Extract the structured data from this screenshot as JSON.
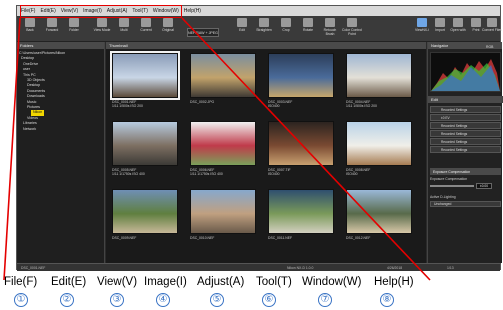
{
  "menubar": {
    "items": [
      "File(F)",
      "Edit(E)",
      "View(V)",
      "Image(I)",
      "Adjust(A)",
      "Tool(T)",
      "Window(W)",
      "Help(H)"
    ]
  },
  "toolbar": {
    "left": [
      "Back",
      "Forward",
      "Folder"
    ],
    "view": [
      "View Mode",
      "Multi",
      "Current",
      "Original"
    ],
    "dropdown": "NEF/RAW + JPEG",
    "edit": [
      "Edit",
      "Straighten",
      "Crop",
      "Rotate",
      "Retouch Brush",
      "Color Control Point"
    ],
    "right": [
      "ViewNX-i",
      "Import",
      "Open with",
      "Print",
      "Convert Files"
    ]
  },
  "left_panel": {
    "title": "Folders",
    "tree": [
      "C:\\Users\\user\\Pictures\\Nikon",
      "Desktop",
      "OneDrive",
      "user",
      "This PC",
      "3D Objects",
      "Desktop",
      "Documents",
      "Downloads",
      "Music",
      "Pictures",
      "Nikon",
      "Videos",
      "Libraries",
      "Network"
    ],
    "selected": "Nikon"
  },
  "center": {
    "title": "Thumbnail",
    "thumbnails": [
      {
        "name": "DSC_0001.NEF",
        "meta": "1/11 1/500s ISO 200"
      },
      {
        "name": "DSC_0002.JPG",
        "meta": ""
      },
      {
        "name": "DSC_0003.NEF",
        "meta": "ISO400"
      },
      {
        "name": "DSC_0004.NEF",
        "meta": "1/11 1/500s ISO 200"
      },
      {
        "name": "DSC_0005.NEF",
        "meta": "1/11 1/1750s ISO 400"
      },
      {
        "name": "DSC_0006.NEF",
        "meta": "1/11 1/1750s ISO 400"
      },
      {
        "name": "DSC_0007.TIF",
        "meta": "ISO400"
      },
      {
        "name": "DSC_0008.NEF",
        "meta": "ISO400"
      },
      {
        "name": "DSC_0009.NEF",
        "meta": ""
      },
      {
        "name": "DSC_0010.NEF",
        "meta": ""
      },
      {
        "name": "DSC_0011.NEF",
        "meta": ""
      },
      {
        "name": "DSC_0012.NEF",
        "meta": ""
      }
    ]
  },
  "right_panel": {
    "navigator": "Navigator",
    "hist_label": "RGB",
    "edit_title": "Edit",
    "settings": [
      "Recorded Settings",
      "±0 EV",
      "Recorded Settings",
      "Recorded Settings",
      "Recorded Settings",
      "Recorded Settings"
    ],
    "exposure_title": "Exposure Compensation",
    "exposure_label": "Exposure Compensation",
    "exposure_value": "±0.00",
    "dlighting_label": "Active D-Lighting",
    "dlighting_value": "Unchanged"
  },
  "status": {
    "left": "DSC_0001.NEF",
    "center": "Nikon NX-D 1.0.0",
    "right": "4/26/2018",
    "page": "1/13"
  },
  "legend": {
    "labels": [
      "File(F)",
      "Edit(E)",
      "View(V)",
      "Image(I)",
      "Adjust(A)",
      "Tool(T)",
      "Window(W)",
      "Help(H)"
    ],
    "numbers": [
      "①",
      "②",
      "③",
      "④",
      "⑤",
      "⑥",
      "⑦",
      "⑧"
    ]
  },
  "colors": {
    "highlight": "#e40000",
    "number_circle": "#3a74c5",
    "folder_selected": "#f2d600"
  }
}
